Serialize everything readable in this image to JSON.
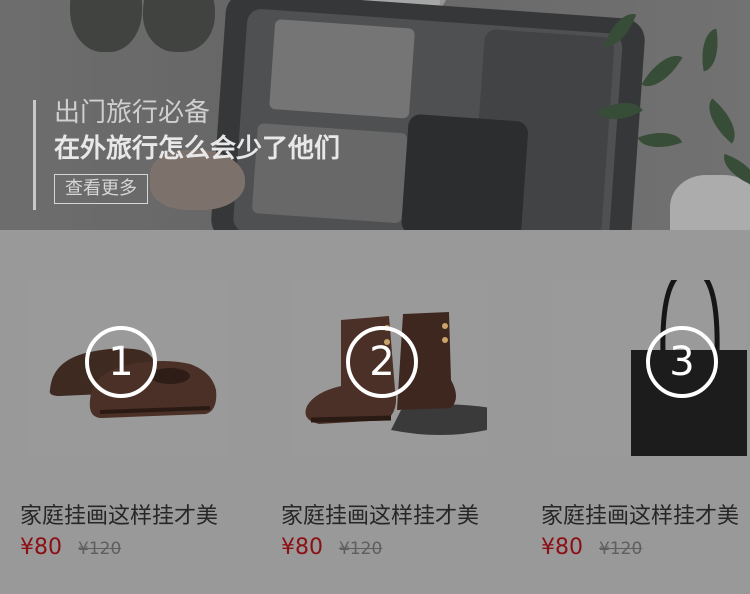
{
  "banner": {
    "subtitle": "出门旅行必备",
    "title": "在外旅行怎么会少了他们",
    "button_label": "查看更多"
  },
  "products": [
    {
      "name": "家庭挂画这样挂才美",
      "price": "¥80",
      "old_price": "¥120",
      "badge": "1",
      "image": "brown-oxford-shoes"
    },
    {
      "name": "家庭挂画这样挂才美",
      "price": "¥80",
      "old_price": "¥120",
      "badge": "2",
      "image": "brown-leather-boots"
    },
    {
      "name": "家庭挂画这样挂才美",
      "price": "¥80",
      "old_price": "¥120",
      "badge": "3",
      "image": "black-tote-bag"
    }
  ],
  "colors": {
    "overlay": "#999999",
    "price": "#8c0f14"
  }
}
